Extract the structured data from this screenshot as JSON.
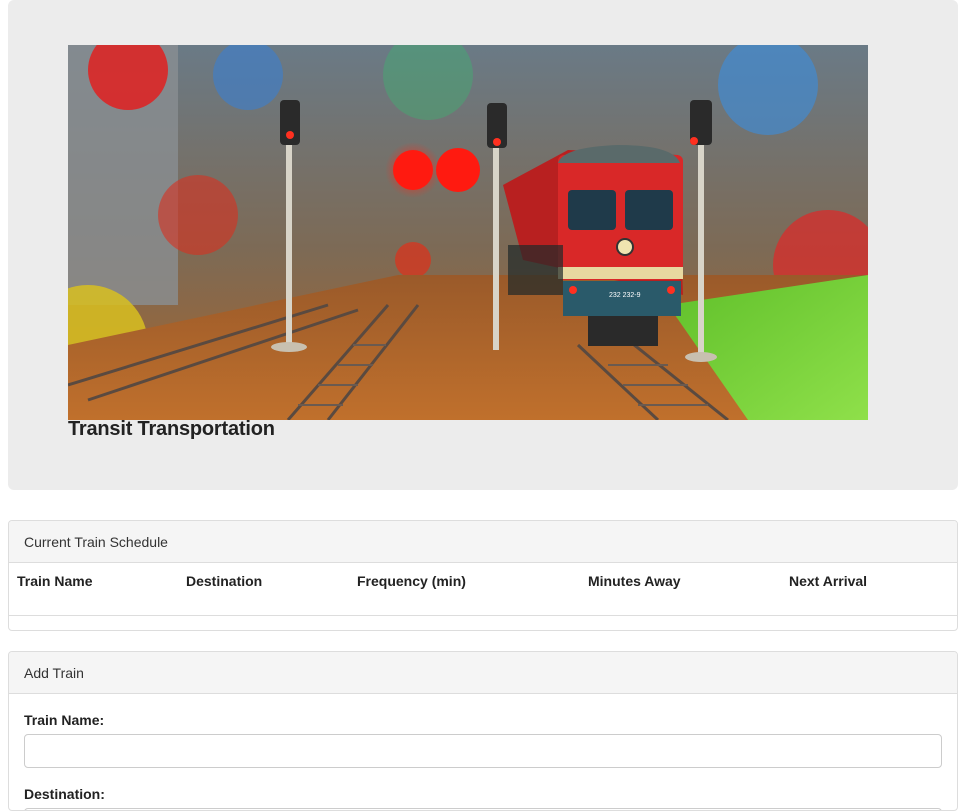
{
  "header": {
    "title": "Transit Transportation"
  },
  "schedule_panel": {
    "heading": "Current Train Schedule",
    "columns": [
      "Train Name",
      "Destination",
      "Frequency (min)",
      "Minutes Away",
      "Next Arrival"
    ],
    "rows": []
  },
  "add_panel": {
    "heading": "Add Train",
    "fields": [
      {
        "label": "Train Name:",
        "value": "",
        "placeholder": ""
      },
      {
        "label": "Destination:",
        "value": "",
        "placeholder": ""
      }
    ]
  },
  "hero_image": {
    "locomotive_number": "232 232-9"
  },
  "colors": {
    "jumbotron_bg": "#ececec",
    "panel_heading_bg": "#f5f5f5",
    "border": "#dddddd"
  }
}
